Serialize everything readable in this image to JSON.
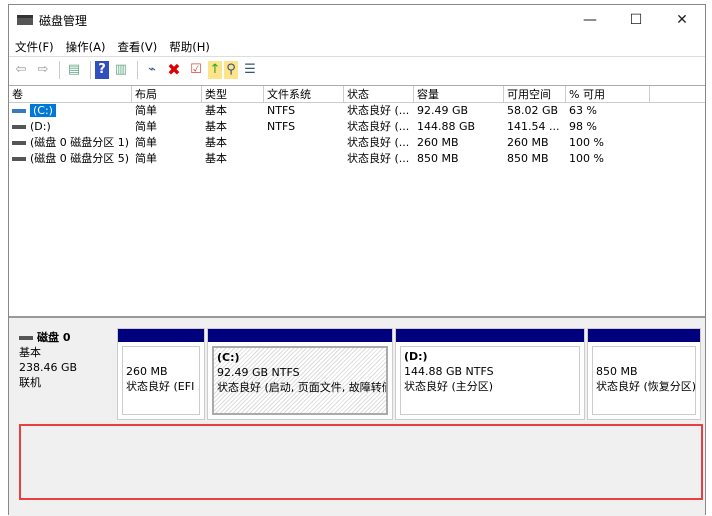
{
  "window": {
    "title": "磁盘管理",
    "minimize": "—",
    "maximize": "☐",
    "close": "✕"
  },
  "menu": [
    "文件(F)",
    "操作(A)",
    "查看(V)",
    "帮助(H)"
  ],
  "toolbar": [
    "back-icon",
    "forward-icon",
    "console-icon",
    "help-icon",
    "view-icon",
    "connect-icon",
    "delete-icon",
    "check-icon",
    "folder-up-icon",
    "search-folder-icon",
    "properties-icon"
  ],
  "table": {
    "headers": [
      "卷",
      "布局",
      "类型",
      "文件系统",
      "状态",
      "容量",
      "可用空间",
      "% 可用",
      ""
    ],
    "rows": [
      [
        "(C:)",
        "简单",
        "基本",
        "NTFS",
        "状态良好 (...",
        "92.49 GB",
        "58.02 GB",
        "63 %"
      ],
      [
        "(D:)",
        "简单",
        "基本",
        "NTFS",
        "状态良好 (...",
        "144.88 GB",
        "141.54 ...",
        "98 %"
      ],
      [
        "(磁盘 0 磁盘分区 1)",
        "简单",
        "基本",
        "",
        "状态良好 (...",
        "260 MB",
        "260 MB",
        "100 %"
      ],
      [
        "(磁盘 0 磁盘分区 5)",
        "简单",
        "基本",
        "",
        "状态良好 (...",
        "850 MB",
        "850 MB",
        "100 %"
      ]
    ]
  },
  "disk": {
    "name": "磁盘 0",
    "type": "基本",
    "size": "238.46 GB",
    "status": "联机"
  },
  "partitions": [
    {
      "label": "",
      "size": "260 MB",
      "status": "状态良好 (EFI 系"
    },
    {
      "label": "(C:)",
      "size": "92.49 GB NTFS",
      "status": "状态良好 (启动, 页面文件, 故障转储"
    },
    {
      "label": "(D:)",
      "size": "144.88 GB NTFS",
      "status": "状态良好 (主分区)"
    },
    {
      "label": "",
      "size": "850 MB",
      "status": "状态良好 (恢复分区)"
    }
  ],
  "colors": {
    "partition_bar": "#00007f",
    "selection": "#0078d7",
    "highlight_box": "#e84040"
  }
}
